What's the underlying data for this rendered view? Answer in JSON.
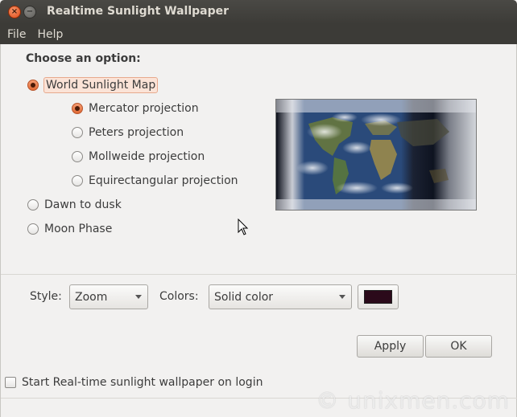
{
  "window": {
    "title": "Realtime Sunlight Wallpaper"
  },
  "menu": {
    "items": [
      "File",
      "Help"
    ]
  },
  "options": {
    "heading": "Choose an option:",
    "world_map": {
      "label": "World Sunlight Map",
      "selected": true
    },
    "projections": [
      {
        "label": "Mercator projection",
        "selected": true
      },
      {
        "label": "Peters projection",
        "selected": false
      },
      {
        "label": "Mollweide projection",
        "selected": false
      },
      {
        "label": "Equirectangular projection",
        "selected": false
      }
    ],
    "dawn_to_dusk": {
      "label": "Dawn to dusk",
      "selected": false
    },
    "moon_phase": {
      "label": "Moon Phase",
      "selected": false
    }
  },
  "settings": {
    "style_label": "Style:",
    "style_value": "Zoom",
    "colors_label": "Colors:",
    "colors_value": "Solid color",
    "color_swatch": "#2b0a1a"
  },
  "buttons": {
    "apply": "Apply",
    "ok": "OK"
  },
  "login_checkbox": {
    "label": "Start Real-time sunlight wallpaper on login",
    "checked": false
  },
  "watermark": "© unixmen.com",
  "colors": {
    "titlebar": "#3c3b37",
    "accent": "#e06a35",
    "background": "#f2f1f0"
  }
}
